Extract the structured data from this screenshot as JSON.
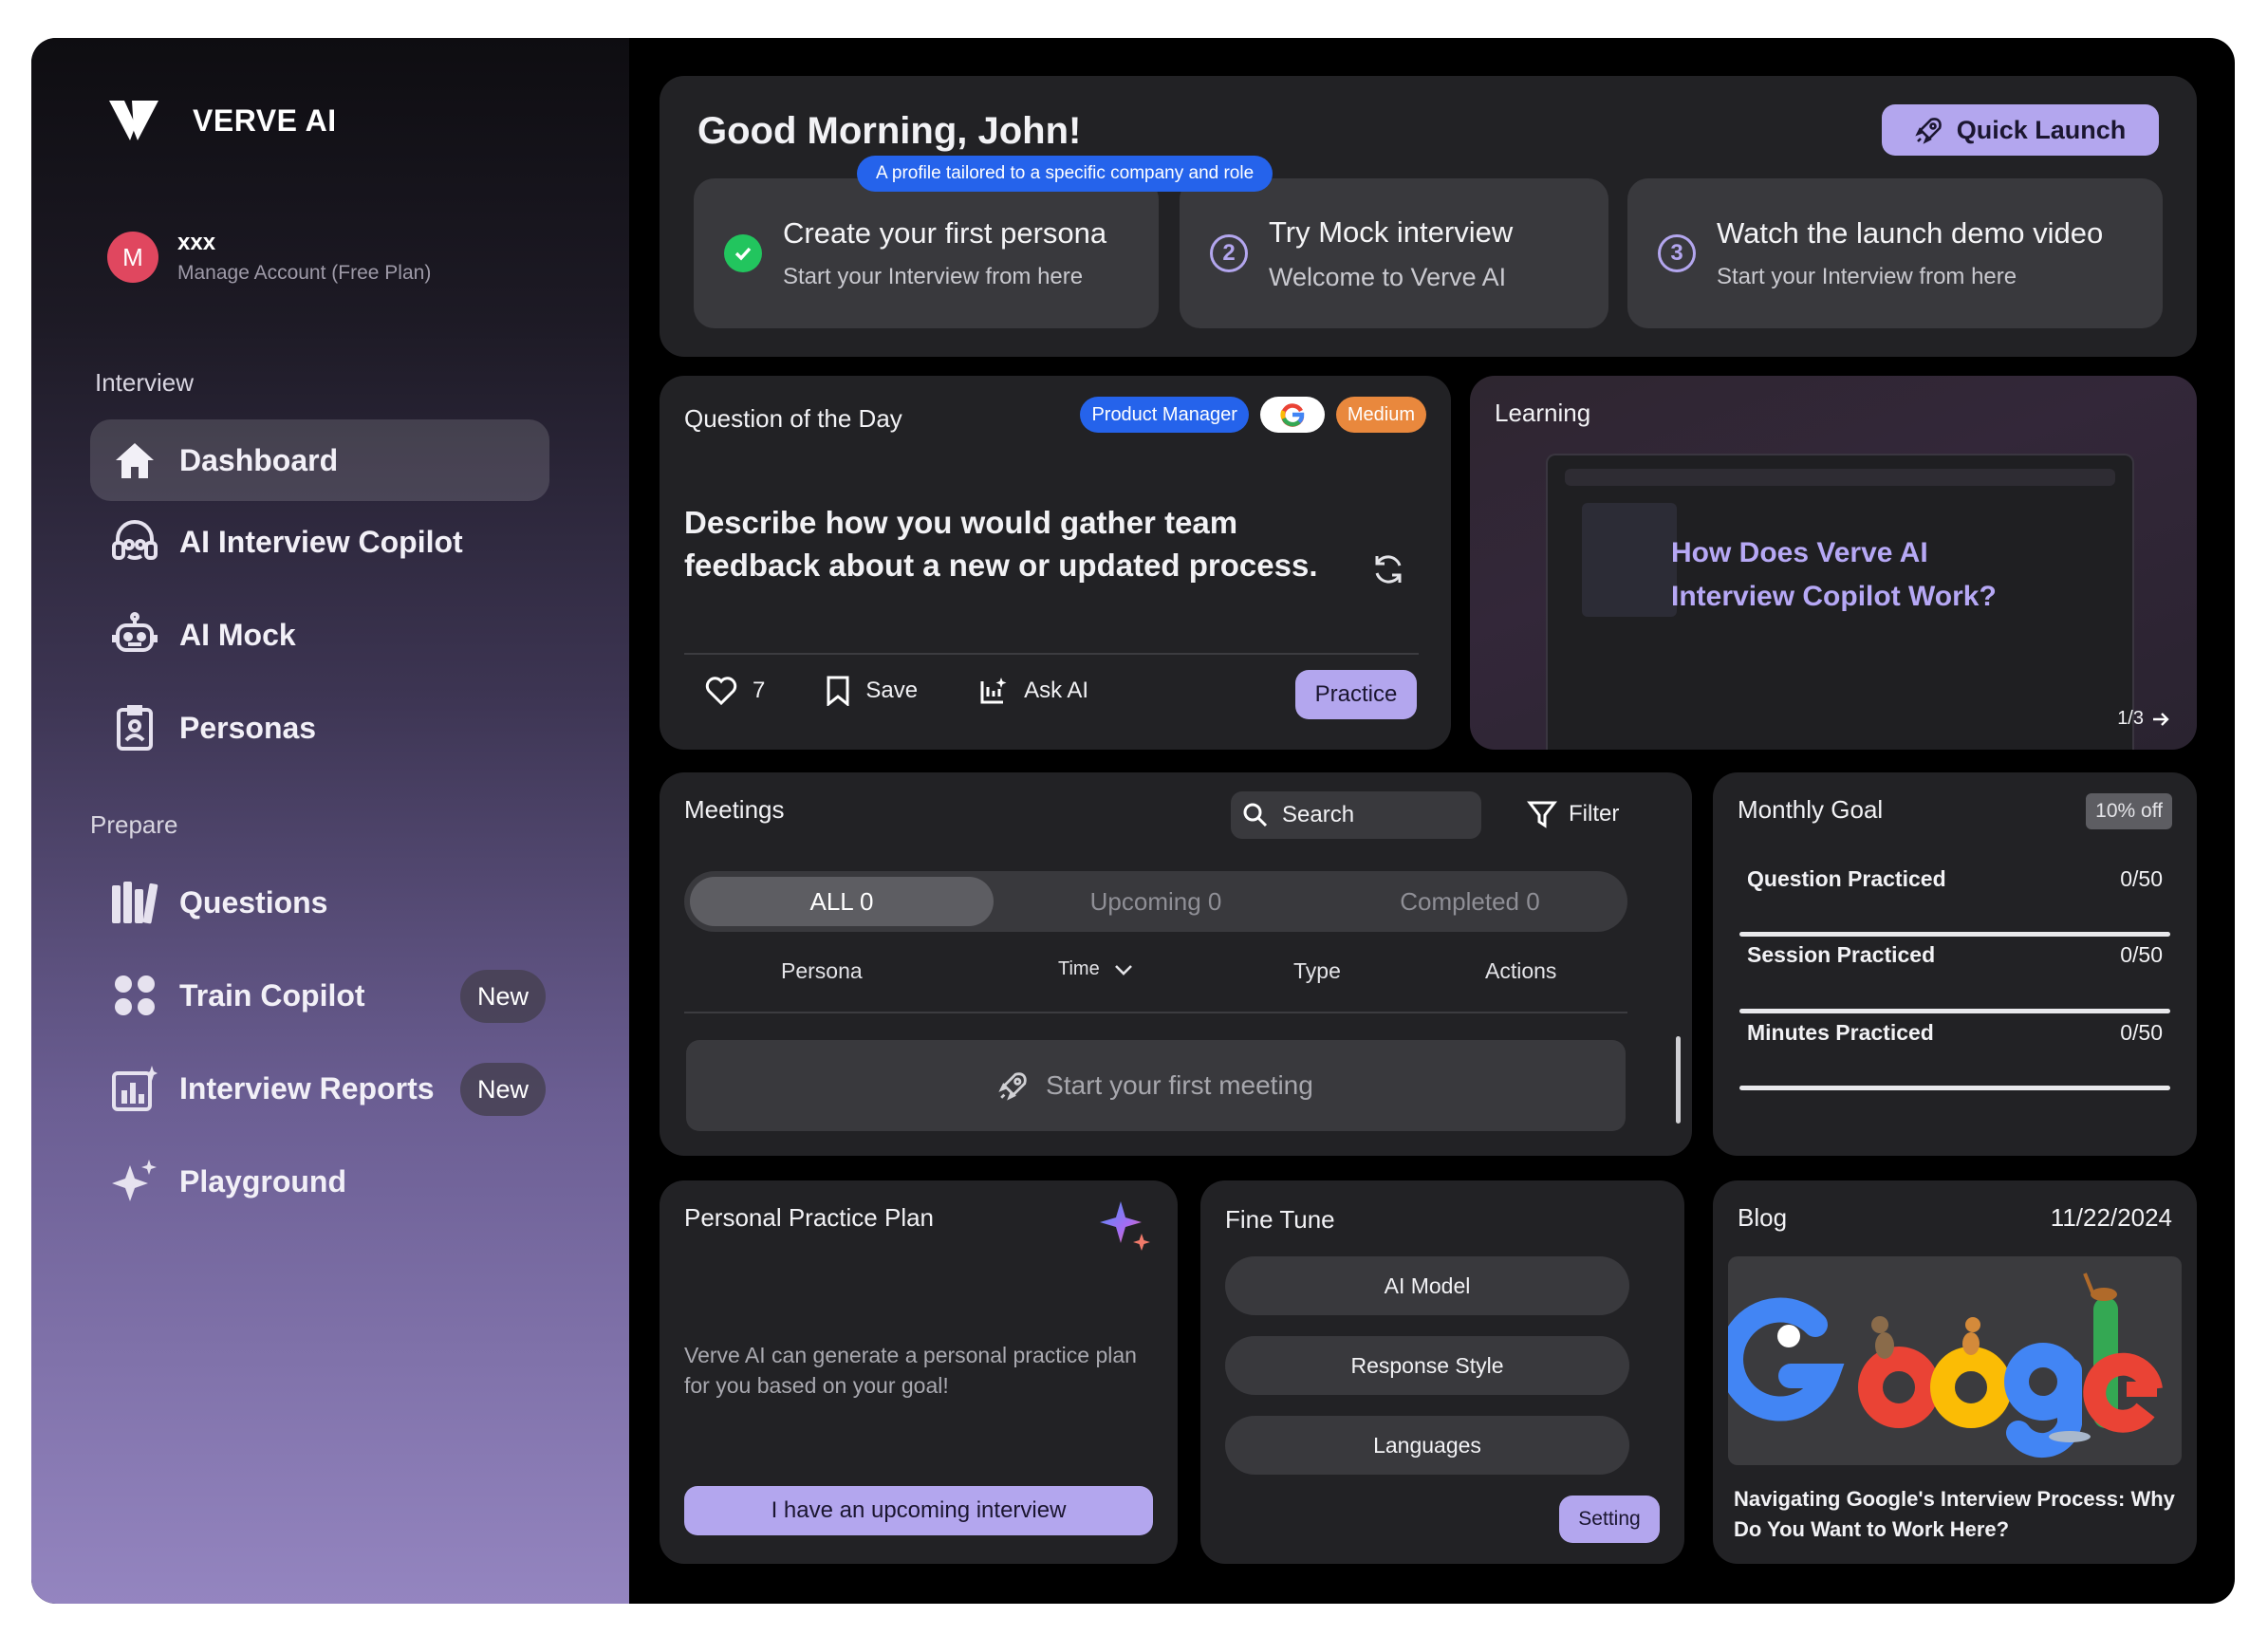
{
  "sidebar": {
    "logo_text": "VERVE AI",
    "account": {
      "avatar_letter": "M",
      "name": "xxx",
      "subtitle": "Manage Account (Free Plan)"
    },
    "section_interview": "Interview",
    "section_prepare": "Prepare",
    "items": [
      {
        "label": "Dashboard",
        "icon": "home-icon",
        "active": true
      },
      {
        "label": "AI Interview Copilot",
        "icon": "headset-icon"
      },
      {
        "label": "AI Mock",
        "icon": "robot-icon"
      },
      {
        "label": "Personas",
        "icon": "id-badge-icon"
      },
      {
        "label": "Questions",
        "icon": "books-icon"
      },
      {
        "label": "Train Copilot",
        "icon": "apps-icon",
        "badge": "New"
      },
      {
        "label": "Interview Reports",
        "icon": "report-chart-icon",
        "badge": "New"
      },
      {
        "label": "Playground",
        "icon": "sparkle-icon"
      }
    ]
  },
  "greeting": {
    "title": "Good Morning, John!",
    "quick_launch": "Quick Launch",
    "tooltip": "A profile tailored to a specific company and role",
    "steps": [
      {
        "title": "Create your first persona",
        "subtitle": "Start your Interview from here",
        "status": "done"
      },
      {
        "number": "2",
        "title": "Try Mock interview",
        "subtitle": "Welcome to Verve AI"
      },
      {
        "number": "3",
        "title": "Watch the launch demo video",
        "subtitle": "Start your Interview from here"
      }
    ]
  },
  "qotd": {
    "title": "Question of the Day",
    "chip_role": "Product Manager",
    "chip_difficulty": "Medium",
    "question": "Describe how you would gather team feedback about a new or updated process.",
    "likes": "7",
    "save": "Save",
    "ask_ai": "Ask AI",
    "practice": "Practice"
  },
  "learning": {
    "title": "Learning",
    "headline_line1": "How Does Verve AI",
    "headline_line2": "Interview Copilot Work?",
    "pager": "1/3"
  },
  "meetings": {
    "title": "Meetings",
    "search_placeholder": "Search",
    "filter": "Filter",
    "tabs": [
      "ALL 0",
      "Upcoming 0",
      "Completed 0"
    ],
    "columns": [
      "Persona",
      "Time",
      "Type",
      "Actions"
    ],
    "empty": "Start your first meeting"
  },
  "goal": {
    "title": "Monthly Goal",
    "badge": "10% off",
    "rows": [
      {
        "label": "Question Practiced",
        "value": "0/50",
        "progress": 0
      },
      {
        "label": "Session Practiced",
        "value": "0/50",
        "progress": 0
      },
      {
        "label": "Minutes Practiced",
        "value": "0/50",
        "progress": 0
      }
    ]
  },
  "plan": {
    "title": "Personal Practice Plan",
    "text": "Verve AI can generate a personal practice plan for you based on your goal!",
    "button": "I have an upcoming interview"
  },
  "finetune": {
    "title": "Fine Tune",
    "options": [
      "AI Model",
      "Response Style",
      "Languages"
    ],
    "setting": "Setting"
  },
  "blog": {
    "title": "Blog",
    "date": "11/22/2024",
    "caption": "Navigating Google's Interview Process: Why Do You Want to Work Here?"
  },
  "colors": {
    "accent": "#b3a6ee",
    "card": "#222225",
    "inner": "#39393d",
    "blue": "#2563eb",
    "orange": "#e9883d",
    "success": "#22c55e"
  }
}
